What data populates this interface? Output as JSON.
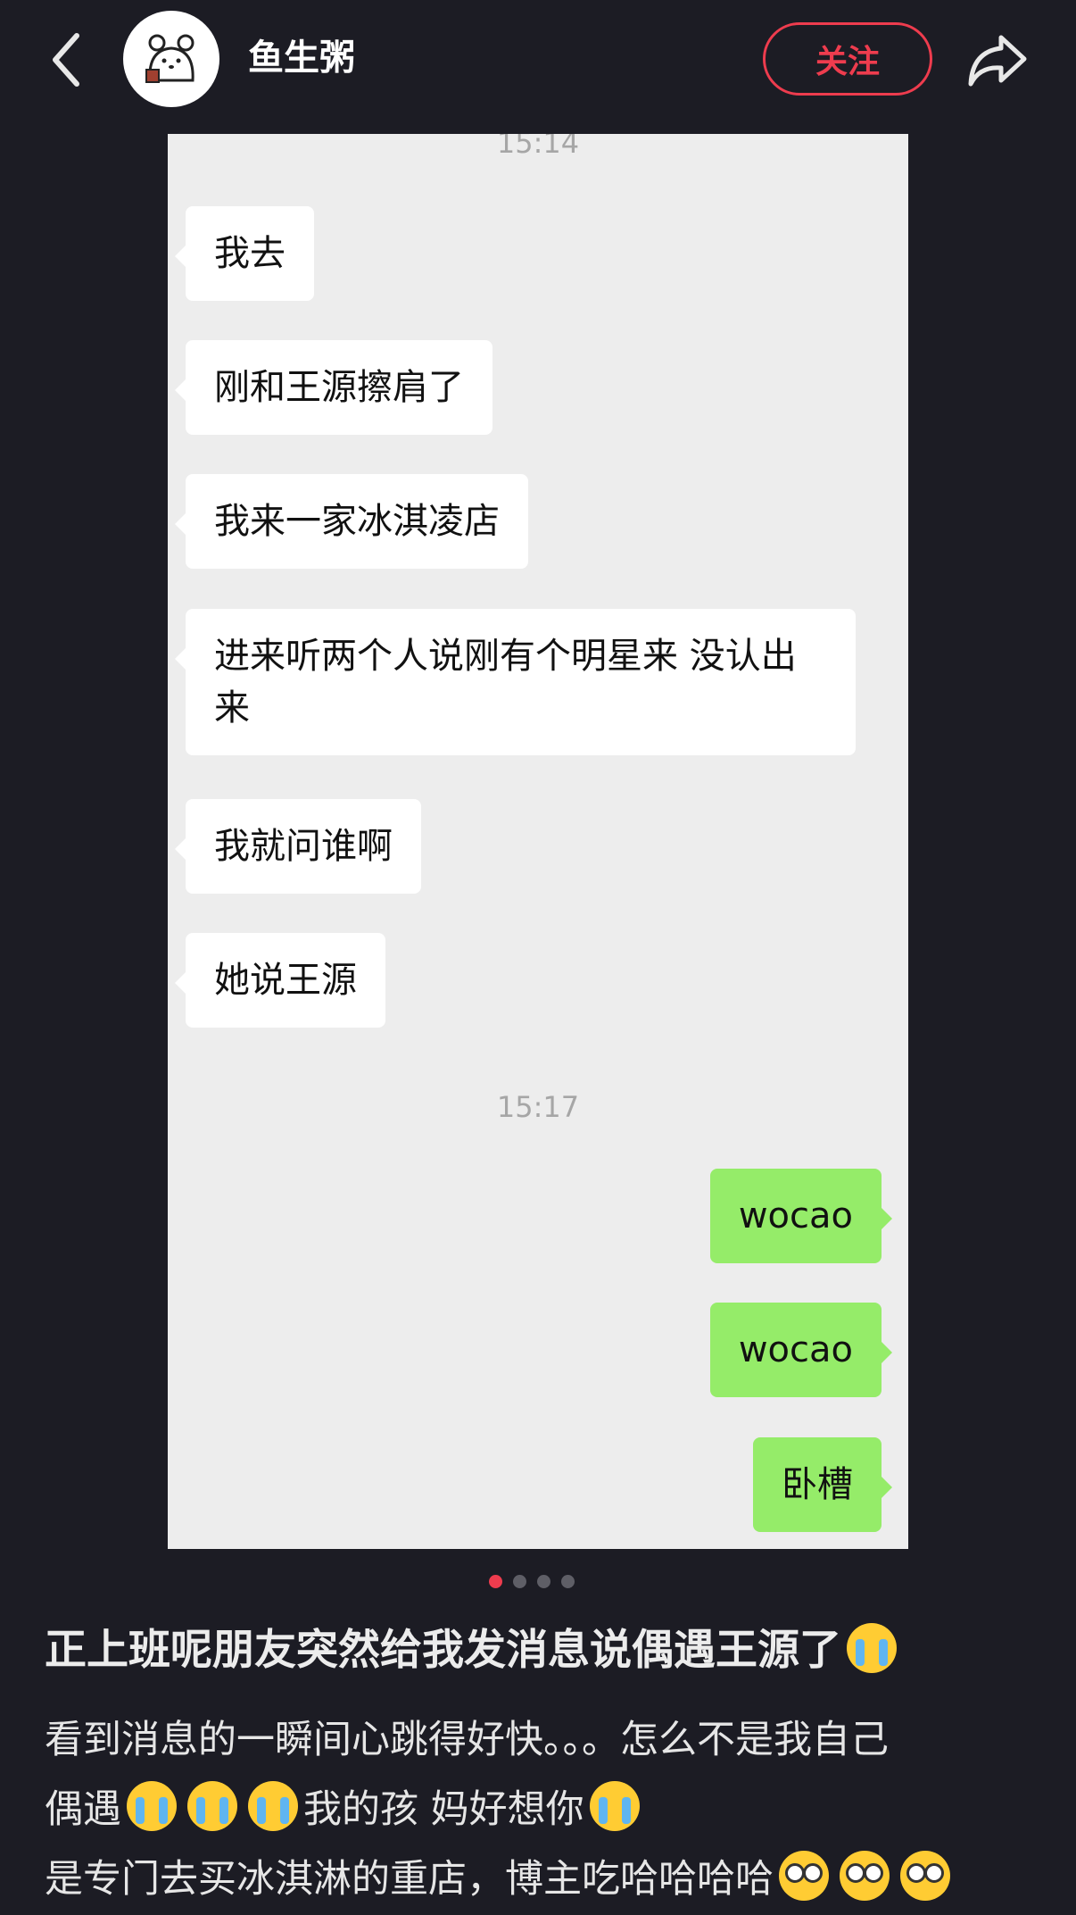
{
  "header": {
    "username": "鱼生粥",
    "follow_label": "关注",
    "icons": {
      "back": "chevron-left-icon",
      "share": "share-arrow-icon",
      "avatar": "bear-avatar-icon"
    },
    "accent_color": "#ee3c4e"
  },
  "chat": {
    "timestamp_1": "15:14",
    "received": [
      "我去",
      "刚和王源擦肩了",
      "我来一家冰淇凌店",
      "进来听两个人说刚有个明星来 没认出来",
      "我就问谁啊",
      "她说王源"
    ],
    "timestamp_2": "15:17",
    "sent": [
      "wocao",
      "wocao",
      "卧槽"
    ],
    "colors": {
      "received_bubble": "#ffffff",
      "sent_bubble": "#95ec69",
      "background": "#ededed"
    }
  },
  "carousel": {
    "total": 4,
    "active": 1
  },
  "post": {
    "title": "正上班呢朋友突然给我发消息说偶遇王源了",
    "line1": "看到消息的一瞬间心跳得好快。。。怎么不是我自己",
    "line2_a": "偶遇",
    "line2_b": "我的孩 妈好想你",
    "line3": "是专门去买冰淇淋的重店，博主吃哈哈哈哈",
    "emoji": {
      "cry": "loudly-crying-face",
      "nerd": "nerd-face"
    }
  }
}
